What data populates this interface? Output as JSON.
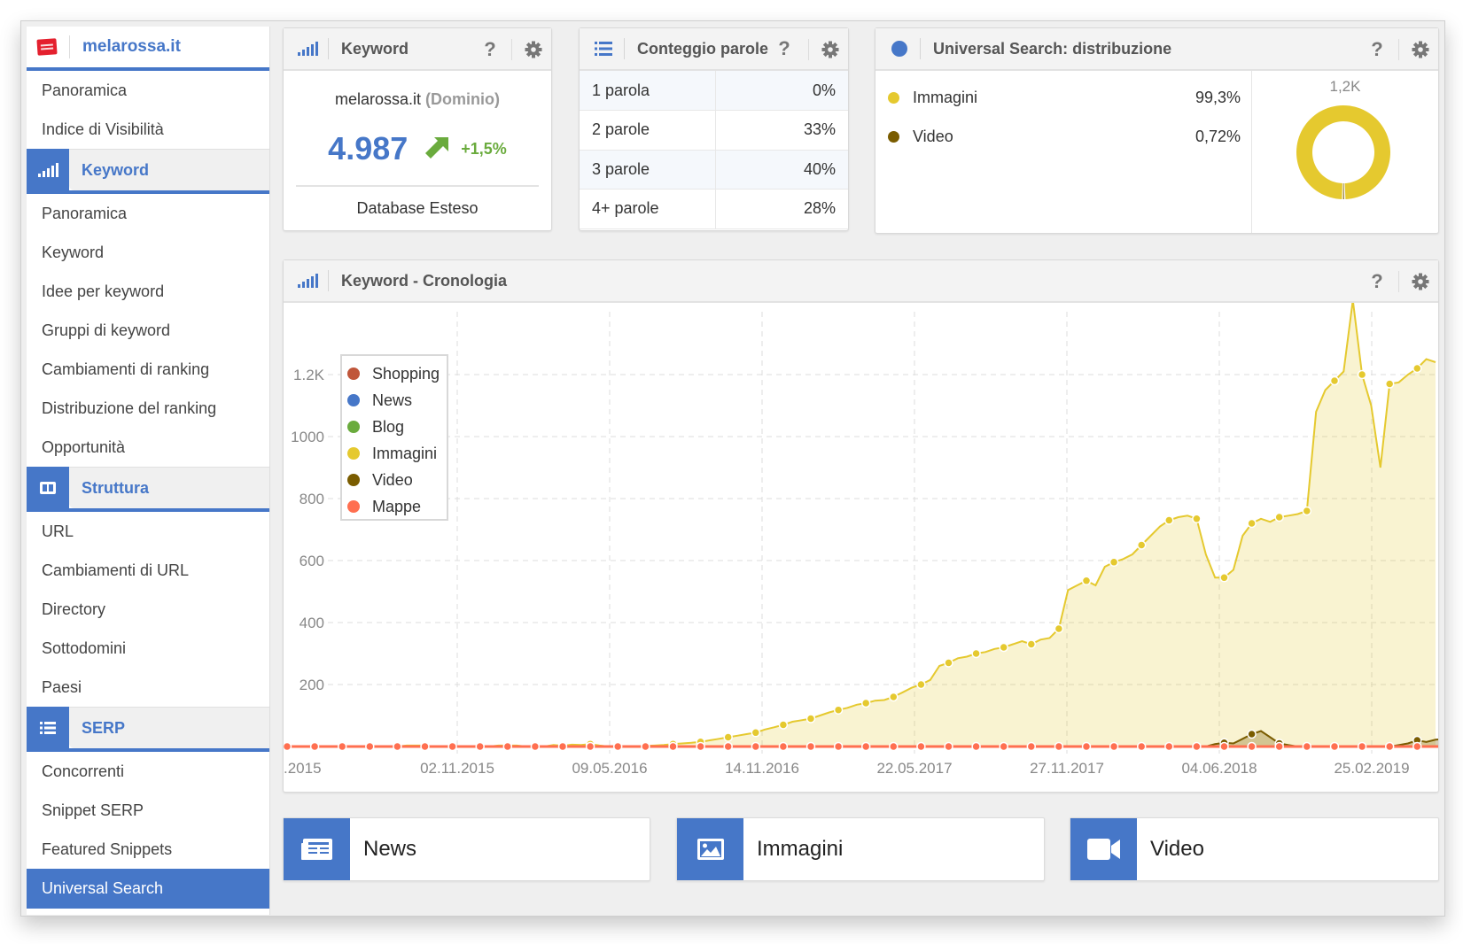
{
  "sidebar": {
    "domain": "melarossa.it",
    "top_items": [
      "Panoramica",
      "Indice di Visibilità"
    ],
    "sections": [
      {
        "label": "Keyword",
        "icon": "signal-bars-icon",
        "items": [
          "Panoramica",
          "Keyword",
          "Idee per keyword",
          "Gruppi di keyword",
          "Cambiamenti di ranking",
          "Distribuzione del ranking",
          "Opportunità"
        ]
      },
      {
        "label": "Struttura",
        "icon": "columns-icon",
        "items": [
          "URL",
          "Cambiamenti di URL",
          "Directory",
          "Sottodomini",
          "Paesi"
        ]
      },
      {
        "label": "SERP",
        "icon": "list-icon",
        "items": [
          "Concorrenti",
          "Snippet SERP",
          "Featured Snippets",
          "Universal Search"
        ]
      }
    ],
    "active_item": "Universal Search"
  },
  "keyword_widget": {
    "title": "Keyword",
    "domain": "melarossa.it",
    "domain_type": "(Dominio)",
    "value": "4.987",
    "change": "+1,5%",
    "trend": "up",
    "database": "Database Esteso"
  },
  "word_count_widget": {
    "title": "Conteggio parole",
    "rows": [
      {
        "label": "1 parola",
        "value": "0%"
      },
      {
        "label": "2 parole",
        "value": "33%"
      },
      {
        "label": "3 parole",
        "value": "40%"
      },
      {
        "label": "4+ parole",
        "value": "28%"
      }
    ]
  },
  "distribution_widget": {
    "title": "Universal Search: distribuzione",
    "rows": [
      {
        "label": "Immagini",
        "value": "99,3%",
        "color": "#e5c92f"
      },
      {
        "label": "Video",
        "value": "0,72%",
        "color": "#7a5c00"
      }
    ],
    "total": "1,2K"
  },
  "history_widget": {
    "title": "Keyword - Cronologia"
  },
  "colors": {
    "accent": "#4677c8",
    "positive": "#6aab3d"
  },
  "chart_data": {
    "type": "area",
    "title": "Keyword - Cronologia",
    "xlabel": "",
    "ylabel": "",
    "ylim": [
      0,
      1400
    ],
    "yticks": [
      200,
      400,
      600,
      800,
      1000,
      1200
    ],
    "ytick_labels": [
      "200",
      "400",
      "600",
      "800",
      "1000",
      "1.2K"
    ],
    "xtick_labels": [
      ".2015",
      "02.11.2015",
      "09.05.2016",
      "14.11.2016",
      "22.05.2017",
      "27.11.2017",
      "04.06.2018",
      "25.02.2019"
    ],
    "grid": true,
    "legend_position": "top-left",
    "legend": [
      {
        "name": "Shopping",
        "color": "#c0563a"
      },
      {
        "name": "News",
        "color": "#4677c8"
      },
      {
        "name": "Blog",
        "color": "#6aab3d"
      },
      {
        "name": "Immagini",
        "color": "#e5c92f"
      },
      {
        "name": "Video",
        "color": "#7a5c00"
      },
      {
        "name": "Mappe",
        "color": "#ff6f50"
      }
    ],
    "series": [
      {
        "name": "Immagini",
        "color": "#e5c92f",
        "values": [
          0,
          0,
          0,
          0,
          0,
          0,
          0,
          0,
          0,
          0,
          0,
          0,
          0,
          3,
          3,
          3,
          0,
          0,
          0,
          0,
          0,
          0,
          0,
          3,
          3,
          3,
          0,
          0,
          0,
          5,
          2,
          6,
          5,
          8,
          3,
          0,
          0,
          0,
          0,
          2,
          3,
          5,
          8,
          10,
          12,
          15,
          20,
          25,
          30,
          35,
          40,
          45,
          55,
          62,
          70,
          80,
          85,
          90,
          100,
          110,
          118,
          125,
          135,
          140,
          148,
          150,
          160,
          175,
          190,
          200,
          215,
          260,
          270,
          285,
          290,
          300,
          305,
          315,
          320,
          330,
          340,
          330,
          345,
          350,
          380,
          505,
          520,
          535,
          520,
          580,
          595,
          605,
          620,
          650,
          680,
          710,
          730,
          740,
          745,
          735,
          620,
          545,
          545,
          570,
          680,
          720,
          735,
          725,
          740,
          745,
          750,
          760,
          1080,
          1150,
          1180,
          1210,
          1440,
          1200,
          1100,
          900,
          1170,
          1175,
          1200,
          1220,
          1250,
          1240
        ]
      },
      {
        "name": "Video",
        "color": "#7a5c00",
        "values": [
          0,
          0,
          0,
          0,
          0,
          0,
          0,
          0,
          0,
          0,
          0,
          0,
          0,
          0,
          0,
          0,
          0,
          0,
          0,
          0,
          0,
          0,
          0,
          0,
          0,
          0,
          0,
          0,
          0,
          0,
          0,
          0,
          0,
          0,
          0,
          0,
          0,
          0,
          0,
          0,
          0,
          0,
          0,
          0,
          0,
          0,
          0,
          0,
          0,
          0,
          0,
          0,
          0,
          0,
          0,
          0,
          0,
          0,
          0,
          0,
          0,
          0,
          0,
          0,
          0,
          0,
          0,
          0,
          0,
          0,
          0,
          0,
          0,
          0,
          0,
          0,
          0,
          0,
          0,
          0,
          0,
          0,
          0,
          0,
          0,
          0,
          0,
          0,
          0,
          0,
          0,
          0,
          0,
          0,
          0,
          0,
          0,
          0,
          0,
          0,
          0,
          8,
          12,
          10,
          25,
          40,
          50,
          30,
          10,
          5,
          0,
          0,
          0,
          0,
          0,
          0,
          0,
          0,
          0,
          0,
          0,
          5,
          10,
          20,
          15,
          22,
          25,
          15,
          10,
          10,
          10,
          10
        ]
      },
      {
        "name": "Mappe",
        "color": "#ff6f50",
        "values": [
          0,
          0,
          0,
          0,
          0,
          0,
          0,
          0,
          0,
          0,
          0,
          0,
          0,
          0,
          0,
          0,
          0,
          0,
          0,
          0,
          0,
          0,
          0,
          0,
          0,
          0,
          0,
          0,
          0,
          0,
          0,
          0,
          0,
          0,
          0,
          0,
          0,
          0,
          0,
          0,
          0,
          0,
          0,
          0,
          0,
          0,
          0,
          0,
          0,
          0,
          0,
          0,
          0,
          0,
          0,
          0,
          0,
          0,
          0,
          0,
          0,
          0,
          0,
          0,
          0,
          0,
          0,
          0,
          0,
          0,
          0,
          0,
          0,
          0,
          0,
          0,
          0,
          0,
          0,
          0,
          0,
          0,
          0,
          0,
          0,
          0,
          0,
          0,
          0,
          0,
          0,
          0,
          0,
          0,
          0,
          0,
          0,
          0,
          0,
          0,
          0,
          0,
          0,
          0,
          0,
          0,
          0,
          0,
          0,
          0,
          0,
          0,
          0,
          0,
          0,
          0,
          0,
          0,
          0,
          0,
          0,
          0,
          0,
          0,
          0,
          0,
          0,
          0,
          0,
          0,
          0,
          0
        ]
      }
    ]
  },
  "bottom_cards": [
    {
      "label": "News",
      "icon": "newspaper-icon"
    },
    {
      "label": "Immagini",
      "icon": "image-icon"
    },
    {
      "label": "Video",
      "icon": "video-camera-icon"
    }
  ]
}
